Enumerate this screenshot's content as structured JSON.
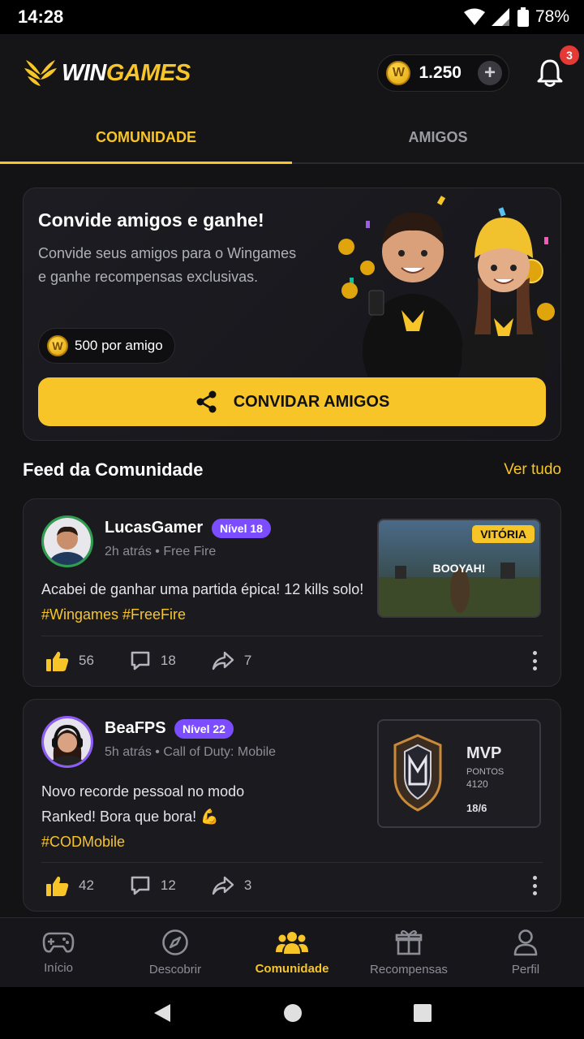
{
  "status_bar": {
    "time": "14:28",
    "battery": "78%"
  },
  "header": {
    "logo_part1": "WIN",
    "logo_part2": "GAMES",
    "coin_symbol": "W",
    "coins": "1.250",
    "notifications_count": "3"
  },
  "tabs": [
    {
      "label": "COMUNIDADE",
      "active": true
    },
    {
      "label": "AMIGOS",
      "active": false
    }
  ],
  "invite": {
    "title": "Convide amigos e ganhe!",
    "description": "Convide seus amigos para o Wingames e ganhe recompensas exclusivas.",
    "reward": "500 por amigo",
    "button": "CONVIDAR AMIGOS"
  },
  "feed": {
    "title": "Feed da Comunidade",
    "see_all": "Ver tudo",
    "posts": [
      {
        "user": "LucasGamer",
        "level": "Nível 18",
        "time": "2h atrás",
        "game": "Free Fire",
        "text": "Acabei de ganhar uma partida épica! 12 kills solo!",
        "hashtags": "#Wingames #FreeFire",
        "thumb_badge": "VITÓRIA",
        "thumb_caption": "BOOYAH!",
        "likes": "56",
        "comments": "18",
        "shares": "7"
      },
      {
        "user": "BeaFPS",
        "level": "Nível 22",
        "time": "5h atrás",
        "game": "Call of Duty: Mobile",
        "text_line1": "Novo recorde pessoal no modo",
        "text_line2": "Ranked! Bora que bora! 💪",
        "hashtags": "#CODMobile",
        "thumb_title": "MVP",
        "thumb_label": "PONTOS",
        "thumb_points": "4120",
        "thumb_kd": "18/6",
        "likes": "42",
        "comments": "12",
        "shares": "3"
      }
    ]
  },
  "bottom_nav": [
    {
      "label": "Início",
      "icon": "gamepad-icon",
      "active": false
    },
    {
      "label": "Descobrir",
      "icon": "compass-icon",
      "active": false
    },
    {
      "label": "Comunidade",
      "icon": "community-icon",
      "active": true
    },
    {
      "label": "Recompensas",
      "icon": "gift-icon",
      "active": false
    },
    {
      "label": "Perfil",
      "icon": "profile-icon",
      "active": false
    }
  ],
  "colors": {
    "accent": "#f7c528",
    "background": "#131316",
    "card": "#1a1a1f",
    "level_badge": "#7c4dff"
  }
}
